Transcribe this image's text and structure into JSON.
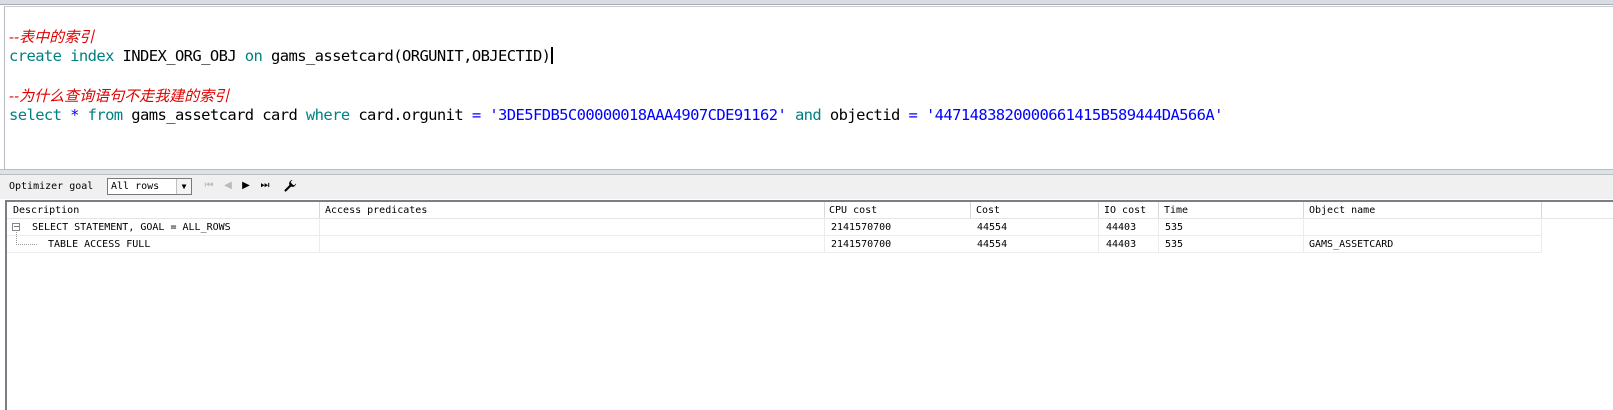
{
  "editor": {
    "line1_comment": "--表中的索引",
    "line2": {
      "kw_create": "create",
      "kw_index": "index",
      "index_name": "INDEX_ORG_OBJ",
      "kw_on": "on",
      "table_expr": "gams_assetcard(ORGUNIT,OBJECTID)"
    },
    "line3_comment": "--为什么查询语句不走我建的索引",
    "line4": {
      "kw_select": "select",
      "star": "*",
      "kw_from": "from",
      "table": "gams_assetcard card",
      "kw_where": "where",
      "col1": "card.orgunit",
      "eq1": "=",
      "val1": "'3DE5FDB5C00000018AAA4907CDE91162'",
      "kw_and": "and",
      "col2": "objectid",
      "eq2": "=",
      "val2": "'4471483820000661415B589444DA566A'"
    }
  },
  "toolbar": {
    "optimizer_label": "Optimizer goal",
    "goal_value": "All rows",
    "nav_first": "⏮",
    "nav_prev": "◀",
    "nav_next": "▶",
    "nav_last": "⏭",
    "wrench_icon": "wrench-icon"
  },
  "plan": {
    "columns": [
      "Description",
      "Access predicates",
      "CPU cost",
      "Cost",
      "IO cost",
      "Time",
      "Object name"
    ],
    "rows": [
      {
        "description": "SELECT STATEMENT, GOAL = ALL_ROWS",
        "access": "",
        "cpu": "2141570700",
        "cost": "44554",
        "io": "44403",
        "time": "535",
        "object": ""
      },
      {
        "description": "TABLE ACCESS FULL",
        "access": "",
        "cpu": "2141570700",
        "cost": "44554",
        "io": "44403",
        "time": "535",
        "object": "GAMS_ASSETCARD"
      }
    ]
  }
}
